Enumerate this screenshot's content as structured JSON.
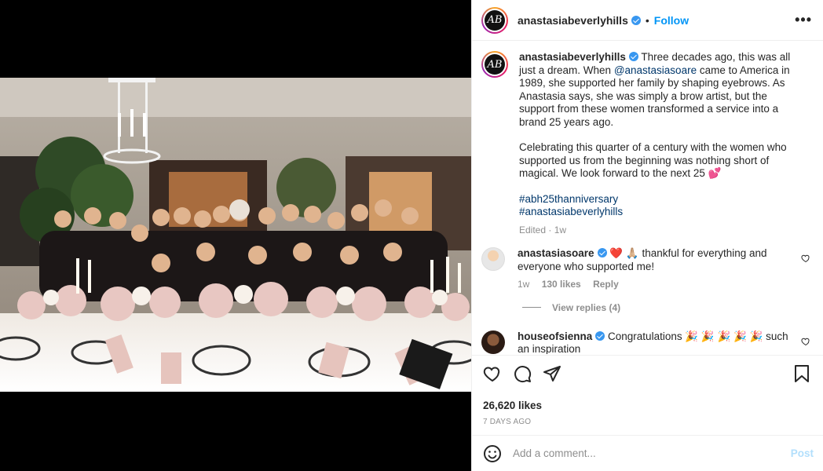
{
  "post": {
    "author": "anastasiabeverlyhills",
    "avatar_monogram": "AB",
    "follow_label": "Follow",
    "separator": "•",
    "more_label": "•••",
    "caption": {
      "part1": "Three decades ago, this was all just a dream. When ",
      "mention": "@anastasiasoare",
      "part2": " came to America in 1989, she supported her family by shaping eyebrows. As Anastasia says, she was simply a brow artist, but the support from these women transformed a service into a brand 25 years ago.",
      "para2": "Celebrating this quarter of a century with the women who supported us from the beginning was nothing short of magical. We look forward to the next 25 💕",
      "hashtag1": "#abh25thanniversary",
      "hashtag2": "#anastasiabeverlyhills",
      "meta_text": "Edited · 1w"
    },
    "likes": "26,620 likes",
    "date": "7 DAYS AGO"
  },
  "comments": [
    {
      "user": "anastasiasoare",
      "text": "❤️ 🙏🏼 thankful for everything and everyone who supported me!",
      "time": "1w",
      "likes": "130 likes",
      "reply": "Reply",
      "view_replies": "View replies (4)"
    },
    {
      "user": "houseofsienna",
      "text": "Congratulations 🎉 🎉 🎉 🎉 🎉 such an inspiration"
    }
  ],
  "add_comment": {
    "placeholder": "Add a comment...",
    "post_label": "Post"
  },
  "icons": [
    "heart-icon",
    "comment-icon",
    "share-icon",
    "save-icon",
    "emoji-icon",
    "verified-badge-icon",
    "more-icon"
  ],
  "colors": {
    "link": "#00376b",
    "accent": "#0095f6",
    "verified": "#3897f0",
    "post_disabled": "#b2dffc"
  }
}
